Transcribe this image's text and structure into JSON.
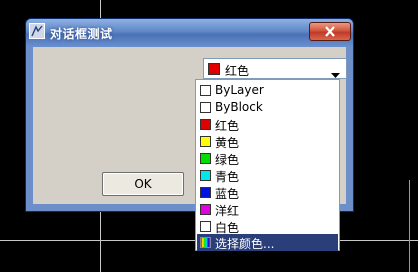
{
  "window": {
    "title": "对话框测试"
  },
  "combo": {
    "selected": "红色",
    "selected_color": "#e00000"
  },
  "ok_button": {
    "label": "OK"
  },
  "dropdown": {
    "items": [
      {
        "label": "ByLayer",
        "color": "#ffffff"
      },
      {
        "label": "ByBlock",
        "color": "#ffffff"
      },
      {
        "label": "红色",
        "color": "#e00000"
      },
      {
        "label": "黄色",
        "color": "#ffff00"
      },
      {
        "label": "绿色",
        "color": "#00e000"
      },
      {
        "label": "青色",
        "color": "#00e8e8"
      },
      {
        "label": "蓝色",
        "color": "#0010e0"
      },
      {
        "label": "洋红",
        "color": "#e000e0"
      },
      {
        "label": "白色",
        "color": "#ffffff"
      },
      {
        "label": "选择颜色...",
        "color": "multicolor"
      }
    ],
    "highlighted": "选择颜色..."
  }
}
